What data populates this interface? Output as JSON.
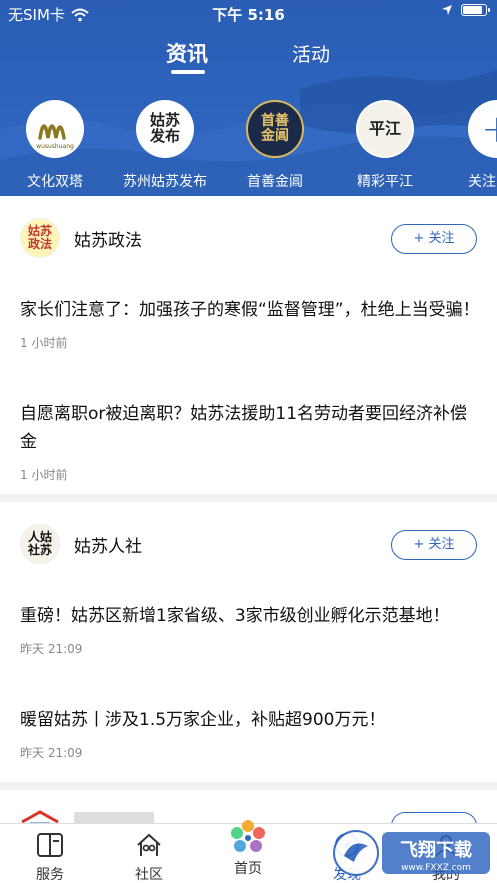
{
  "status_bar": {
    "carrier": "无SIM卡",
    "time": "下午 5:16"
  },
  "top_tabs": [
    {
      "label": "资讯",
      "active": true
    },
    {
      "label": "活动",
      "active": false
    }
  ],
  "channels": [
    {
      "name": "文化双塔",
      "logo_text": "lle",
      "logo_sub": "wusushuang"
    },
    {
      "name": "苏州姑苏发布",
      "logo_text": "姑苏发布"
    },
    {
      "name": "首善金阊",
      "logo_text": "首善金阊"
    },
    {
      "name": "精彩平江",
      "logo_text": "平江"
    },
    {
      "name": "关注",
      "logo_text": "+"
    }
  ],
  "feed": [
    {
      "source": "姑苏政法",
      "avatar_text": "姑苏政法",
      "follow_label": "+ 关注",
      "articles": [
        {
          "title": "家长们注意了：加强孩子的寒假“监督管理”，杜绝上当受骗！",
          "time": "1 小时前"
        },
        {
          "title": "自愿离职or被迫离职？姑苏法援助11名劳动者要回经济补偿金",
          "time": "1 小时前"
        }
      ]
    },
    {
      "source": "姑苏人社",
      "avatar_text": "人姑社苏",
      "follow_label": "+ 关注",
      "articles": [
        {
          "title": "重磅！姑苏区新增1家省级、3家市级创业孵化示范基地！",
          "time": "昨天 21:09"
        },
        {
          "title": "暖留姑苏丨涉及1.5万家企业，补贴超900万元！",
          "time": "昨天 21:09"
        }
      ]
    }
  ],
  "bottom_tabs": [
    {
      "label": "服务",
      "icon": "book-icon"
    },
    {
      "label": "社区",
      "icon": "community-icon"
    },
    {
      "label": "首页",
      "icon": "home-flower-icon"
    },
    {
      "label": "发现",
      "icon": "discover-icon",
      "active": true
    },
    {
      "label": "我的",
      "icon": "profile-icon"
    }
  ],
  "watermark": {
    "text": "飞翔下载",
    "url_text": "www.FXXZ.com"
  },
  "colors": {
    "brand_blue": "#2f66c0",
    "text": "#111111",
    "muted": "#888888"
  }
}
